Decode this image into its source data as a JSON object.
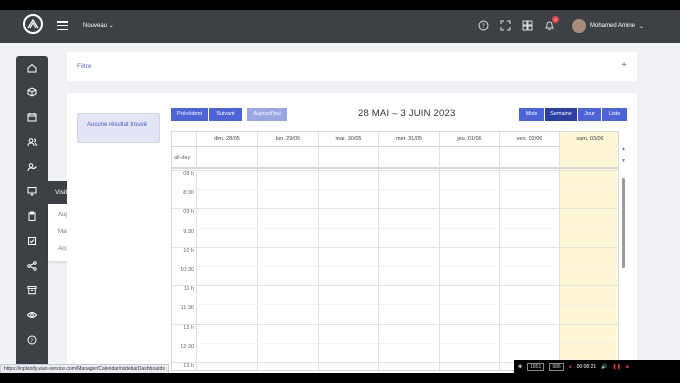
{
  "colors": {
    "accent": "#4c64d8",
    "topbar": "#3d4044",
    "today_highlight": "#fdf7d8",
    "badge": "#e5484d"
  },
  "header": {
    "new_label": "Nouveau",
    "notification_count": "9",
    "user_name": "Mohamed Amine",
    "icons": [
      "help-icon",
      "fullscreen-icon",
      "apps-grid-icon",
      "bell-icon"
    ]
  },
  "sidebar": {
    "icons": [
      "home-icon",
      "cube-icon",
      "calendar-icon",
      "users-icon",
      "user-check-icon",
      "monitor-icon",
      "clipboard-icon",
      "checklist-icon",
      "share-icon",
      "archive-icon",
      "eye-icon",
      "help-circle-icon"
    ],
    "flyout": {
      "title": "Visites médicales",
      "items": [
        "Aujourd'hui",
        "Manquées",
        "Accompagnées"
      ]
    }
  },
  "filter": {
    "label": "Filtre",
    "toggle": "+"
  },
  "results": {
    "empty_message": "Aucune résultat trouvé"
  },
  "calendar": {
    "nav": {
      "prev": "Précédent",
      "next": "Suivant",
      "today": "Aujourd'hui"
    },
    "title": "28 MAI – 3 JUIN 2023",
    "views": {
      "month": "Mois",
      "week": "Semaine",
      "day": "Jour",
      "list": "Liste"
    },
    "active_view": "Semaine",
    "days": [
      "dim. 28/05",
      "lun. 29/05",
      "mar. 30/05",
      "mer. 31/05",
      "jeu. 01/06",
      "ven. 02/06",
      "sam. 03/06"
    ],
    "allday_label": "all-day",
    "times": [
      "08 h",
      "8:30",
      "09 h",
      "9:30",
      "10 h",
      "10:30",
      "11 h",
      "11:30",
      "12 h",
      "12:30",
      "13 h"
    ]
  },
  "status_url": "https://inplanify.wan-service.com/Manager/Calendar#sidebarDashboards",
  "recorder": {
    "res1": "1851",
    "res2": "986",
    "time": "00:08:21"
  }
}
